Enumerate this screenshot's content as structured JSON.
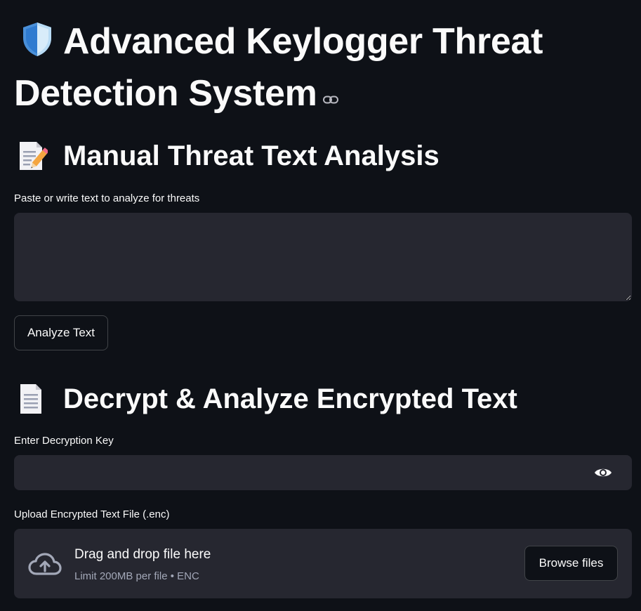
{
  "header": {
    "title": "Advanced Keylogger Threat Detection System",
    "title_icon": "shield-icon"
  },
  "manual": {
    "heading": "Manual Threat Text Analysis",
    "heading_icon": "memo-icon",
    "input_label": "Paste or write text to analyze for threats",
    "input_value": "",
    "analyze_button": "Analyze Text"
  },
  "decrypt": {
    "heading": "Decrypt & Analyze Encrypted Text",
    "heading_icon": "page-icon",
    "key_label": "Enter Decryption Key",
    "key_value": "",
    "upload_label": "Upload Encrypted Text File (.enc)",
    "dropzone_main": "Drag and drop file here",
    "dropzone_sub": "Limit 200MB per file • ENC",
    "browse_button": "Browse files"
  },
  "colors": {
    "background": "#0e1117",
    "input_bg": "#262730",
    "text": "#fafafa",
    "muted": "#a3a8b8"
  }
}
